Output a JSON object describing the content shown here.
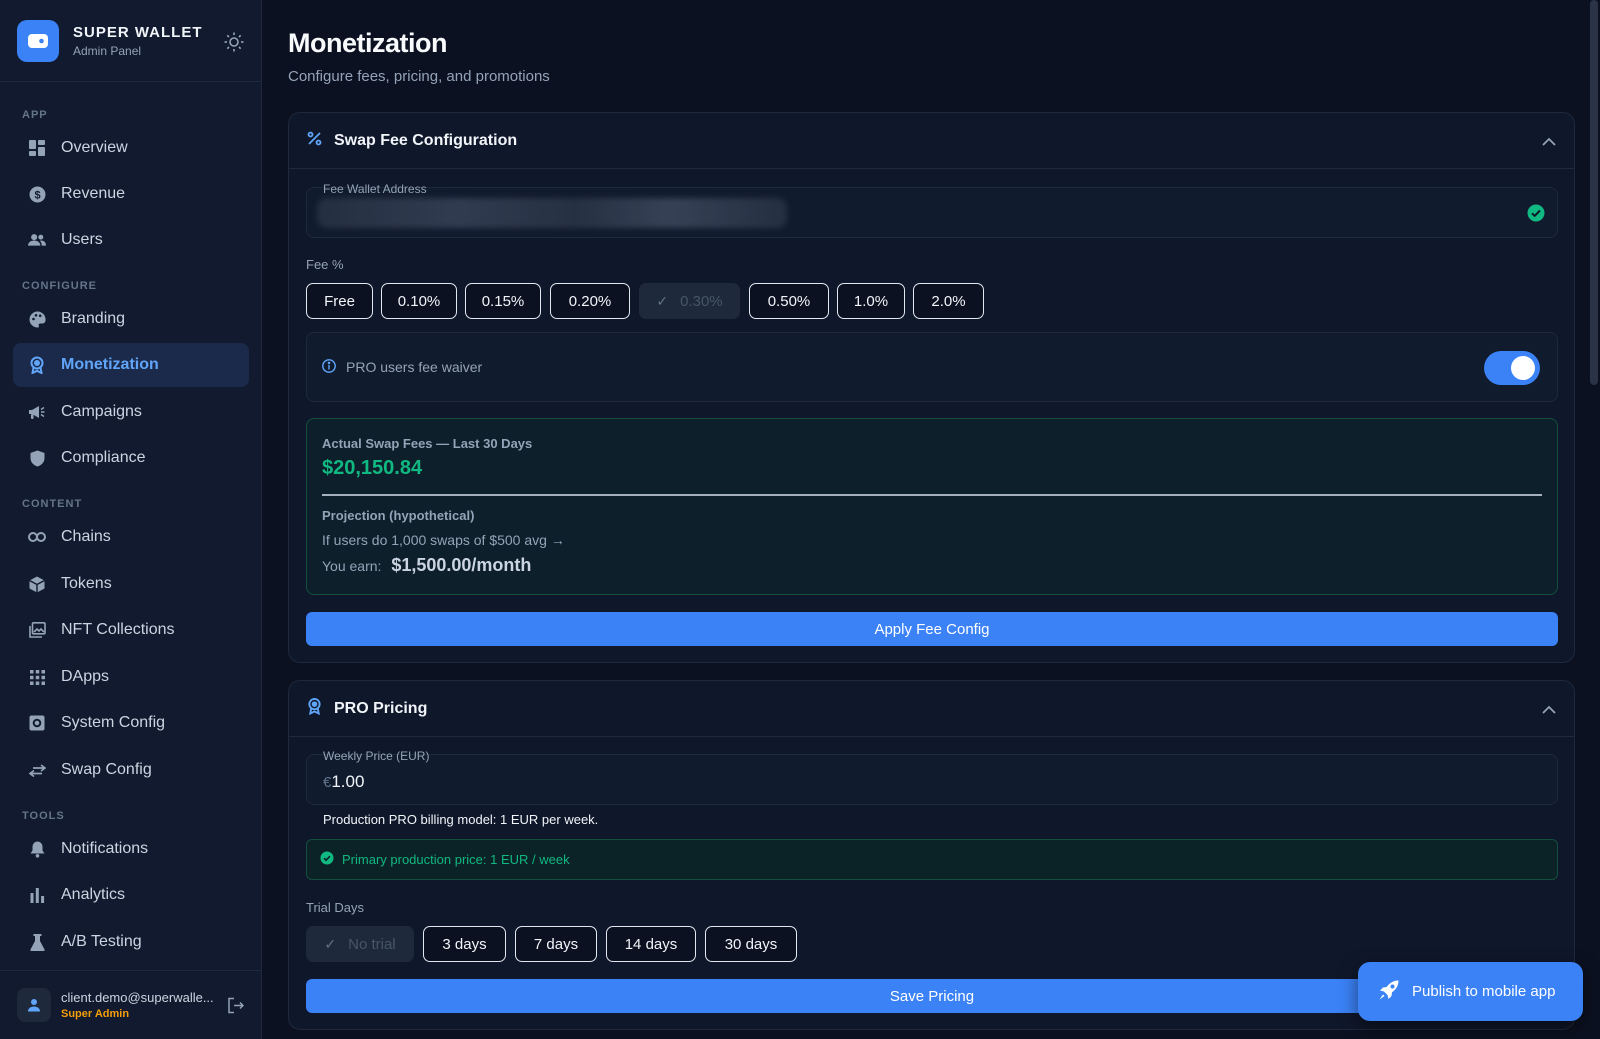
{
  "brand": {
    "name": "SUPER WALLET",
    "subtitle": "Admin Panel"
  },
  "sidebar": {
    "sections": {
      "app": "APP",
      "configure": "CONFIGURE",
      "content": "CONTENT",
      "tools": "TOOLS"
    },
    "items": {
      "overview": "Overview",
      "revenue": "Revenue",
      "users": "Users",
      "branding": "Branding",
      "monetization": "Monetization",
      "campaigns": "Campaigns",
      "compliance": "Compliance",
      "chains": "Chains",
      "tokens": "Tokens",
      "nft": "NFT Collections",
      "dapps": "DApps",
      "system": "System Config",
      "swap": "Swap Config",
      "notifications": "Notifications",
      "analytics": "Analytics",
      "ab": "A/B Testing"
    },
    "active": "Monetization"
  },
  "user": {
    "email": "client.demo@superwalle...",
    "role": "Super Admin"
  },
  "page": {
    "title": "Monetization",
    "subtitle": "Configure fees, pricing, and promotions"
  },
  "swap_fee": {
    "title": "Swap Fee Configuration",
    "wallet_label": "Fee Wallet Address",
    "fee_label": "Fee %",
    "options": [
      "Free",
      "0.10%",
      "0.15%",
      "0.20%",
      "0.30%",
      "0.50%",
      "1.0%",
      "2.0%"
    ],
    "selected": "0.30%",
    "waiver_label": "PRO users fee waiver",
    "waiver_enabled": true,
    "actual_label": "Actual Swap Fees — Last 30 Days",
    "actual_amount": "$20,150.84",
    "projection_label": "Projection (hypothetical)",
    "projection_text": "If users do 1,000 swaps of $500 avg →",
    "earn_label": "You earn:",
    "earn_value": "$1,500.00/month",
    "apply_label": "Apply Fee Config"
  },
  "pro_pricing": {
    "title": "PRO Pricing",
    "weekly_label": "Weekly Price (EUR)",
    "currency": "€",
    "weekly_value": "1.00",
    "billing_note": "Production PRO billing model: 1 EUR per week.",
    "primary_note": "Primary production price: 1 EUR / week",
    "trial_label": "Trial Days",
    "trial_options": [
      "No trial",
      "3 days",
      "7 days",
      "14 days",
      "30 days"
    ],
    "trial_selected": "No trial",
    "save_label": "Save Pricing"
  },
  "publish_label": "Publish to mobile app",
  "colors": {
    "accent": "#3b82f6",
    "success": "#10b981",
    "warning": "#f59e0b",
    "background": "#0b1120"
  }
}
